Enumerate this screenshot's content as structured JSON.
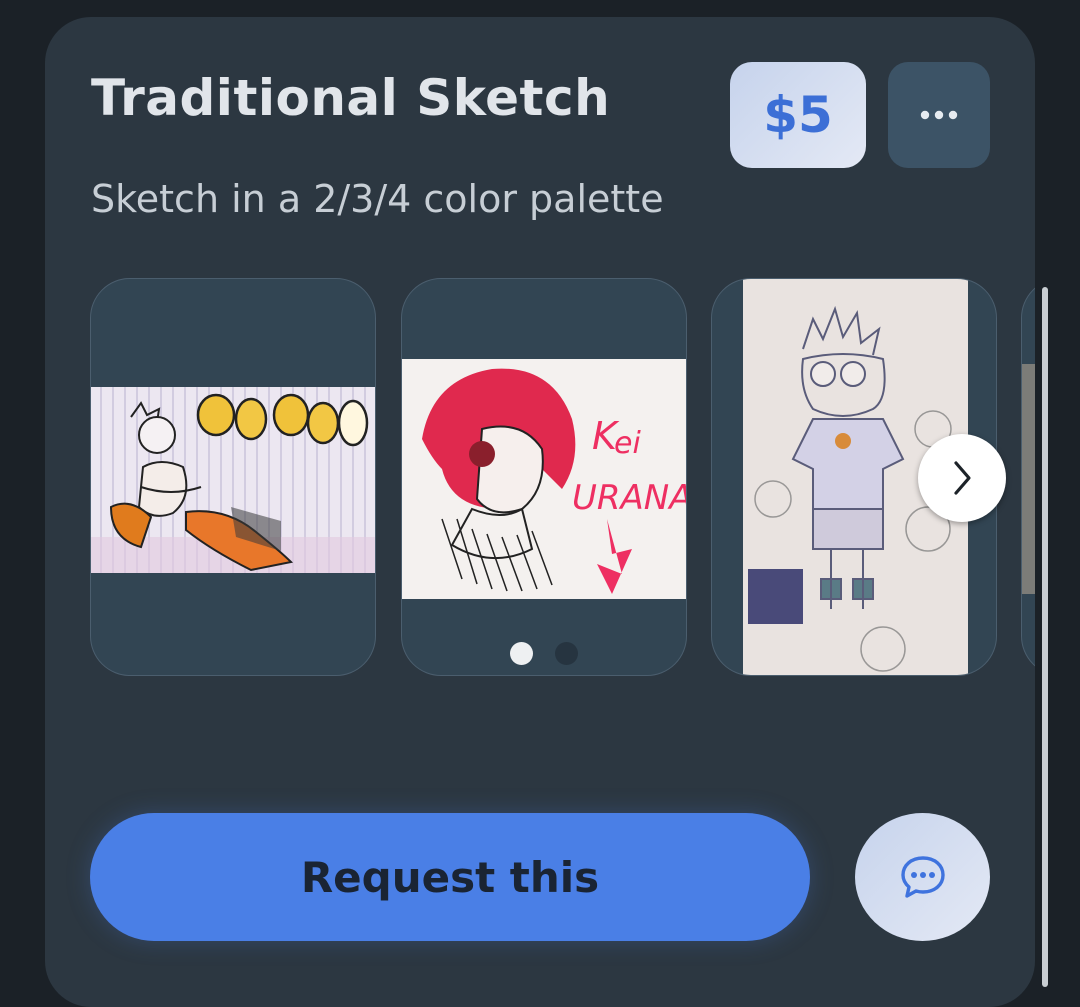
{
  "listing": {
    "title": "Traditional Sketch",
    "description": "Sketch in a 2/3/4 color palette",
    "price": "$5"
  },
  "gallery": {
    "images": [
      {
        "name": "sketch-oh-boy-artwork"
      },
      {
        "name": "sketch-kei-urana-artwork",
        "dots": 2,
        "active_dot": 0
      },
      {
        "name": "sketch-spiky-hair-character-artwork"
      }
    ]
  },
  "actions": {
    "request_label": "Request this"
  },
  "colors": {
    "accent": "#4a7fe6",
    "price_text": "#3c6fd6",
    "card_bg": "#2c3741",
    "page_bg": "#1b2127"
  },
  "icons": {
    "more": "ellipsis-icon",
    "next": "chevron-right-icon",
    "chat": "chat-bubble-icon"
  }
}
